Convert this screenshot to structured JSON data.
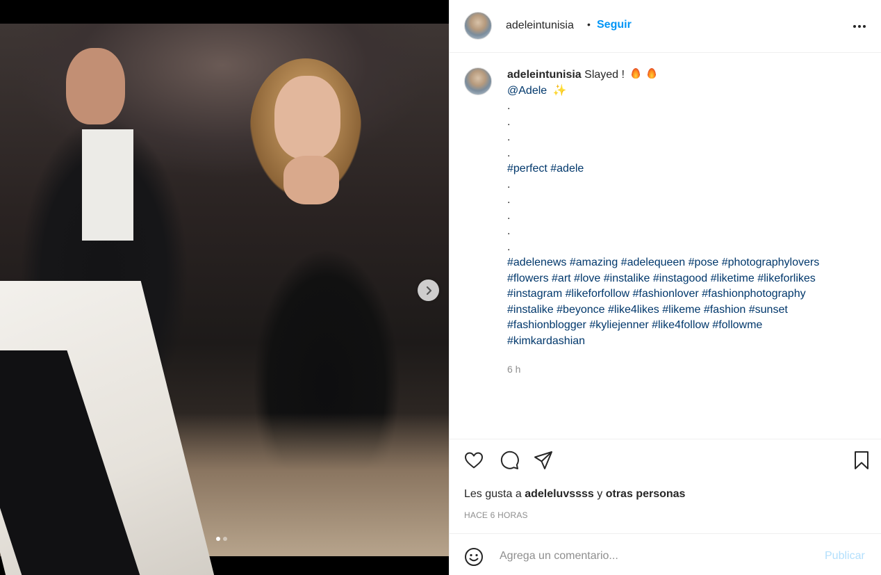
{
  "header": {
    "username": "adeleintunisia",
    "separator": "•",
    "follow_label": "Seguir"
  },
  "caption": {
    "username": "adeleintunisia",
    "text": "Slayed !",
    "mention": "@Adele",
    "dots_a": [
      ".",
      ".",
      ".",
      "."
    ],
    "tags_a": "#perfect #adele",
    "dots_b": [
      ".",
      ".",
      ".",
      ".",
      "."
    ],
    "hashtag_lines": [
      "#adelenews #amazing #adelequeen #pose #photographylovers",
      "#flowers #art #love #instalike #instagood #liketime #likeforlikes",
      "#instagram #likeforfollow #fashionlover #fashionphotography",
      "#instalike #beyonce #like4likes #likeme #fashion #sunset",
      "#fashionblogger #kyliejenner #like4follow #followme",
      "#kimkardashian"
    ],
    "time": "6 h"
  },
  "likes": {
    "prefix": "Les gusta a",
    "user": "adeleluvssss",
    "joiner": "y",
    "others": "otras personas"
  },
  "timeago": "HACE 6 HORAS",
  "comment": {
    "placeholder": "Agrega un comentario...",
    "publish_label": "Publicar"
  },
  "carousel": {
    "current": 1,
    "total": 2
  },
  "icons": {
    "like": "heart-icon",
    "comment": "comment-bubble-icon",
    "share": "paper-plane-icon",
    "save": "bookmark-icon",
    "emoji": "smiley-icon",
    "next": "chevron-right-icon",
    "more": "more-horizontal-icon"
  },
  "colors": {
    "accent": "#0095f6",
    "hashtag": "#00376b",
    "publish_disabled": "#b2dffc",
    "muted": "#8e8e8e"
  }
}
